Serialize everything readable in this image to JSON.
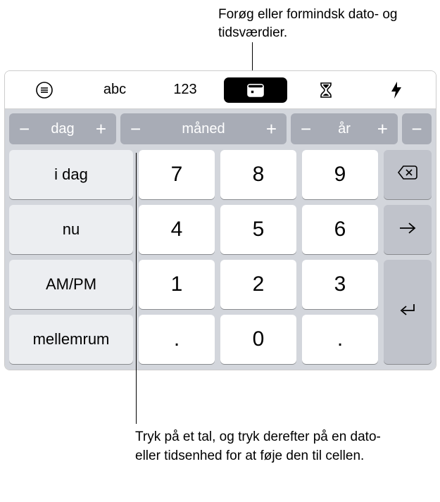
{
  "callouts": {
    "top": "Forøg eller formindsk dato- og tidsværdier.",
    "bottom": "Tryk på et tal, og tryk derefter på en dato- eller tidsenhed for at føje den til cellen."
  },
  "toolbar": {
    "abc_label": "abc",
    "num_label": "123"
  },
  "steppers": {
    "minus": "−",
    "plus": "+",
    "day": "dag",
    "month": "måned",
    "year": "år"
  },
  "side_keys": {
    "today": "i dag",
    "now": "nu",
    "ampm": "AM/PM",
    "space": "mellemrum"
  },
  "digits": {
    "d7": "7",
    "d8": "8",
    "d9": "9",
    "d4": "4",
    "d5": "5",
    "d6": "6",
    "d1": "1",
    "d2": "2",
    "d3": "3",
    "d0": "0",
    "dot": ".",
    "dot2": "."
  }
}
